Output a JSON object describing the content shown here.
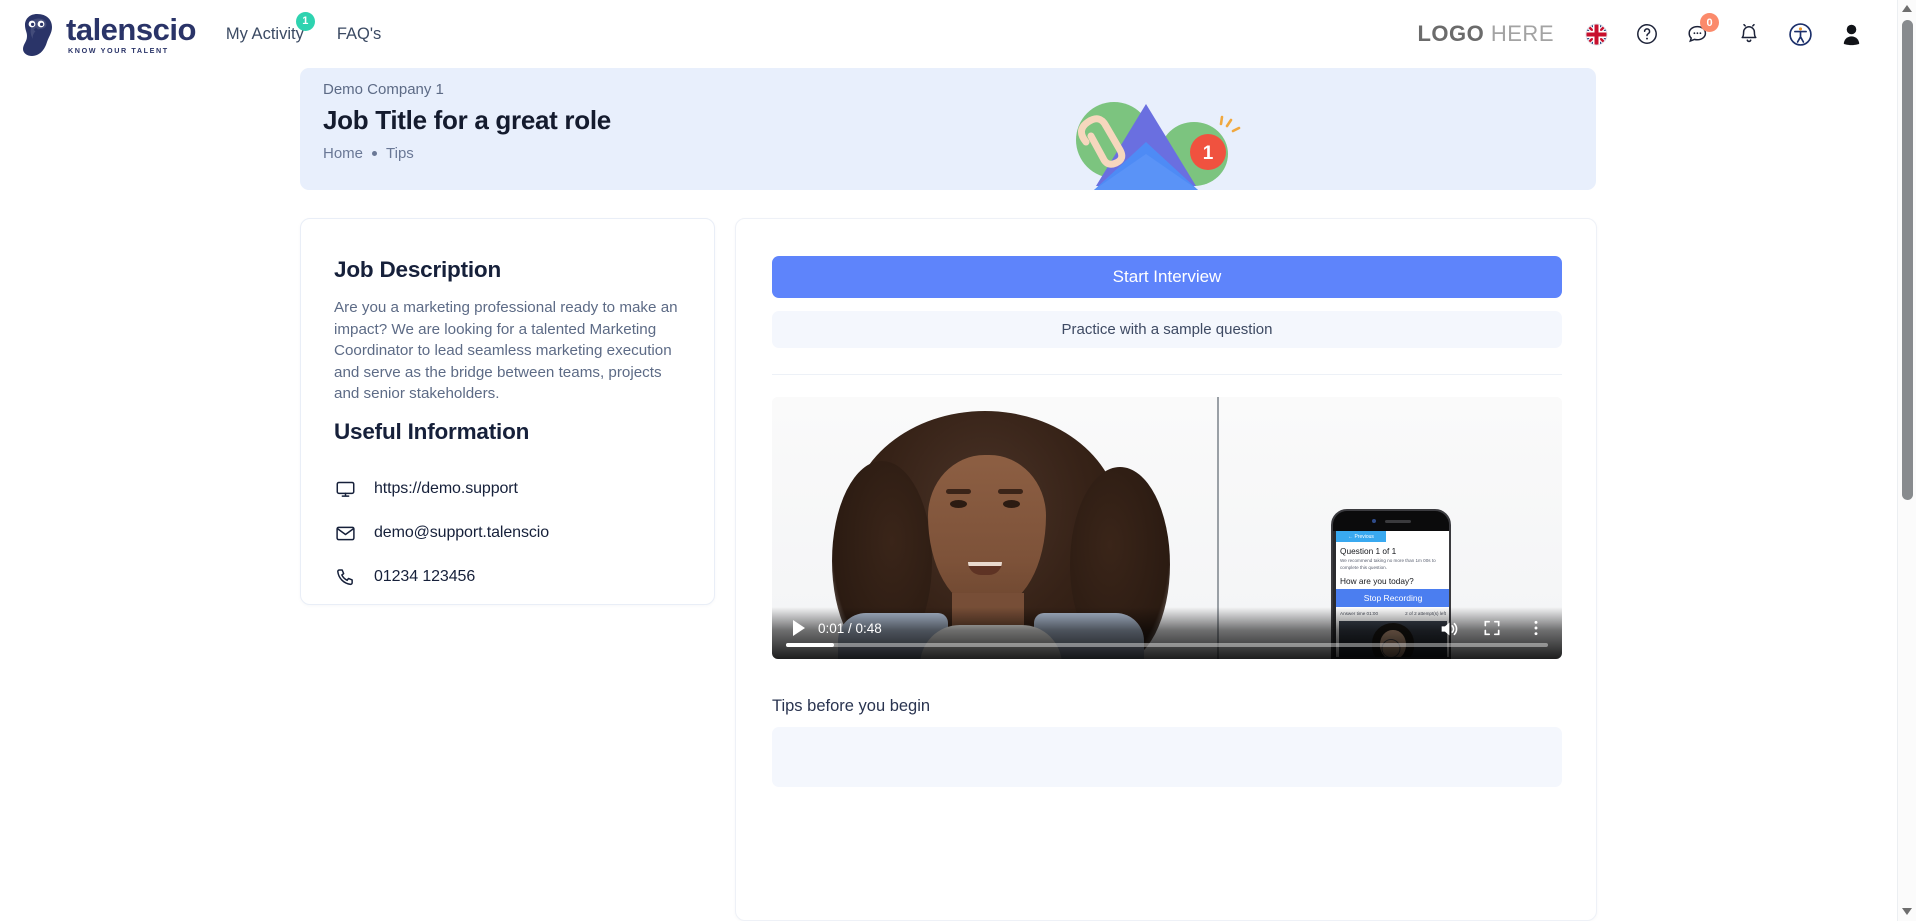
{
  "nav": {
    "brand": {
      "word": "talenscio",
      "tagline": "KNOW YOUR TALENT",
      "icon": "owl-logo-icon"
    },
    "links": [
      {
        "label": "My Activity",
        "badge": "1"
      },
      {
        "label": "FAQ's",
        "badge": null
      }
    ],
    "client_logo": {
      "bold": "LOGO",
      "light": "HERE"
    },
    "icons": [
      {
        "name": "language-flag-uk-icon",
        "badge": null
      },
      {
        "name": "help-circle-icon",
        "badge": null
      },
      {
        "name": "chat-bubble-icon",
        "badge": "0"
      },
      {
        "name": "notification-bell-icon",
        "badge": null
      },
      {
        "name": "accessibility-icon",
        "badge": null
      },
      {
        "name": "user-avatar-icon",
        "badge": null
      }
    ]
  },
  "banner": {
    "company": "Demo Company 1",
    "title": "Job Title for a great role",
    "breadcrumb": [
      "Home",
      "Tips"
    ],
    "art": "envelope-illustration",
    "art_badge": "1",
    "bg_color": "#e8effc"
  },
  "job_description": {
    "heading": "Job Description",
    "body": "Are you a marketing professional ready to make an impact? We are looking for a talented Marketing Coordinator to lead seamless marketing execution and serve as the bridge between teams, projects and senior stakeholders."
  },
  "useful_information": {
    "heading": "Useful Information",
    "items": [
      {
        "icon": "monitor-icon",
        "text": "https://demo.support"
      },
      {
        "icon": "mail-icon",
        "text": "demo@support.talenscio"
      },
      {
        "icon": "phone-icon",
        "text": "01234 123456"
      }
    ]
  },
  "actions": {
    "start_label": "Start Interview",
    "practice_label": "Practice with a sample question",
    "start_color": "#5e84fb"
  },
  "video": {
    "time_display": "0:01 / 0:48",
    "current_time": "0:01",
    "duration": "0:48",
    "progress_percent": 6,
    "controls": [
      "play-icon",
      "volume-icon",
      "fullscreen-icon",
      "more-options-icon"
    ],
    "phone_mock": {
      "previous_label": "← Previous",
      "question_counter": "Question 1 of 1",
      "recommendation": "We recommend taking no more than 1m 00s to complete this question.",
      "question_text": "How are you today?",
      "record_button": "Stop Recording",
      "answer_time": "Answer time 01:00",
      "attempts": "2 of 2 attempt(s) left"
    }
  },
  "tips": {
    "heading": "Tips before you begin"
  }
}
